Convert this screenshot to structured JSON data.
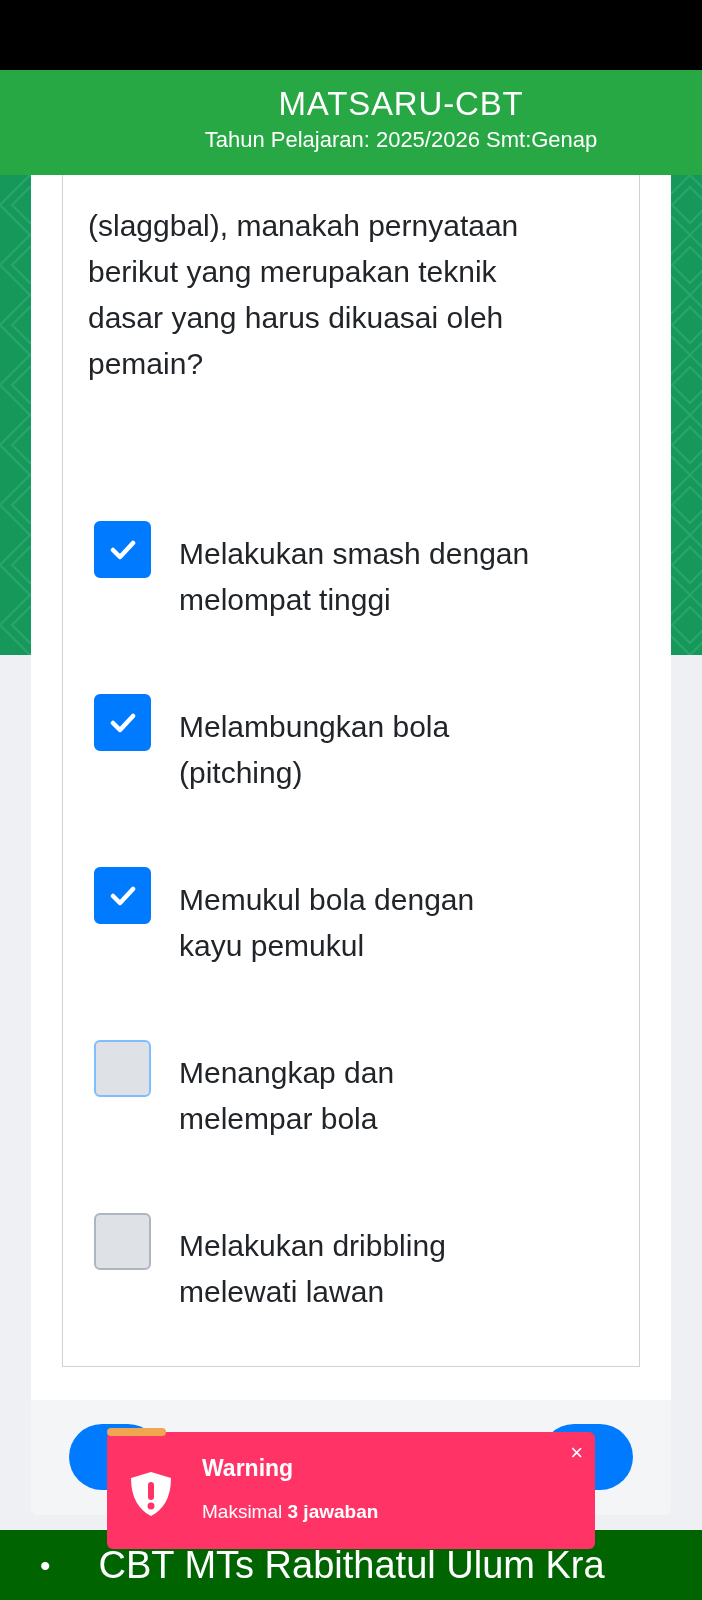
{
  "header": {
    "title": "MATSARU-CBT",
    "subtitle": "Tahun Pelajaran: 2025/2026 Smt:Genap"
  },
  "question": "(slaggbal), manakah pernyataan berikut yang merupakan teknik dasar yang harus dikuasai oleh pemain?",
  "options": [
    {
      "label": "Melakukan smash dengan melompat tinggi",
      "checked": true,
      "focused": false
    },
    {
      "label": "Melambungkan bola (pitching)",
      "checked": true,
      "focused": false
    },
    {
      "label": "Memukul bola dengan kayu pemukul",
      "checked": true,
      "focused": false
    },
    {
      "label": "Menangkap dan melempar bola",
      "checked": false,
      "focused": true
    },
    {
      "label": "Melakukan dribbling melewati lawan",
      "checked": false,
      "focused": false
    }
  ],
  "toast": {
    "level": 0.12,
    "title": "Warning",
    "message": "Maksimal **3 jawaban**",
    "close": "×"
  },
  "ticker": {
    "bullet": "•",
    "text": "CBT MTs Rabithatul Ulum Kra"
  }
}
